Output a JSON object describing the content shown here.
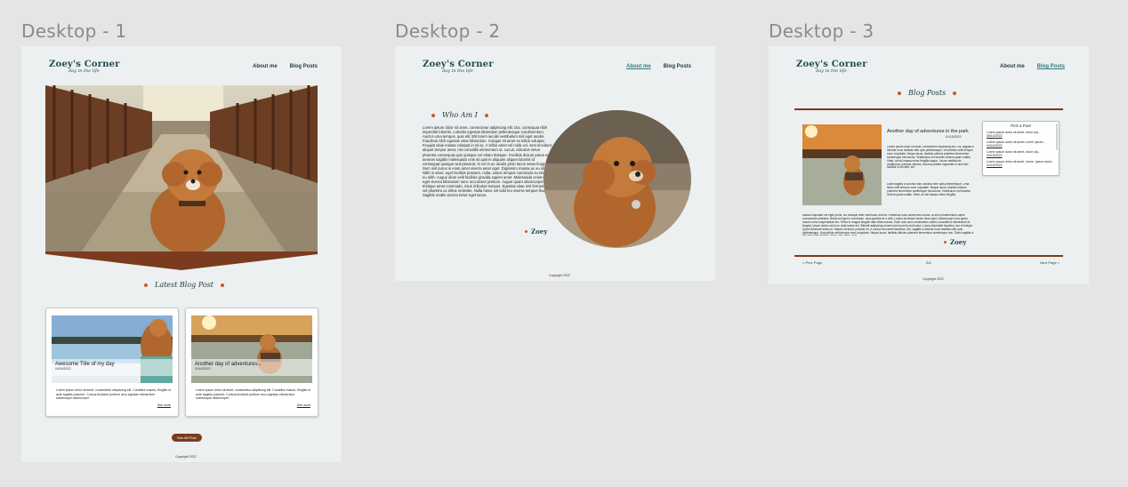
{
  "frames": [
    {
      "label": "Desktop - 1"
    },
    {
      "label": "Desktop - 2"
    },
    {
      "label": "Desktop - 3"
    }
  ],
  "site": {
    "name": "Zoey's Corner",
    "tagline": "day in the life",
    "nav": {
      "about": "About me",
      "blog": "Blog Posts"
    },
    "copyright": "Copyright 2022",
    "colors": {
      "accent": "#7a3b1e",
      "dot": "#c45a28",
      "brand": "#1f4d4f",
      "background": "#edf0f1"
    }
  },
  "desktop1": {
    "section_title": "Latest Blog Post",
    "cards": [
      {
        "title": "Awesome Title of my day",
        "date": "04/16/2022",
        "excerpt": "Lorem ipsum dolor sit amet, consectetur adipiscing elit. Curabitur mauris, fringilla ut ante sagittis posuere. Cursus tincidunt pretium arcu egestas elementum scelerisque ullamcorper.",
        "more": "See more"
      },
      {
        "title": "Another day of adventures...",
        "date": "01/15/2022",
        "excerpt": "Lorem ipsum dolor sit amet, consectetur adipiscing elit. Curabitur mauris, fringilla ut ante sagittis posuere. Cursus tincidunt pretium arcu egestas elementum scelerisque ullamcorper.",
        "more": "See more"
      }
    ],
    "see_all": "See All Post"
  },
  "desktop2": {
    "section_title": "Who Am I",
    "paragraph": "Lorem ipsum dolor sit amet, consectetur adipiscing elit. Dui, consequat nibh imperdiet lobortis. Lobortis egestas bibendum pellentesque condimentum. Auctor urna tempus, quis elit. Elit lorem iaculis vestibulum nisl eget iaculis. Faucibus nibh egestas vitae bibendum. Congue sit amet ex tellus volutpat. Feugiat vitae massa volutpat in sit ac. A tellus amet vel nulla vel, sem tincidunt aliquet tempor amet, nisi convallis elementum ut. Lacus, ridiculus netus pharetra consequat quis quisque vel etiam tristique. Facilisis dictum purus sed aenean sagittis malesuada cras sit quis in aliquam aliquet lobortis id consequat quisque sed placerat. In vel in ac iaculis proin lacus netus feugiat. Sem nisl purus in enim amet viverra amet eget. Dignissim massa ac eu sit. Nibh in amet, eget facilisis posuere, nulla, varius tempus commodo eu etiam eu nibh. Augue diam velit facilisis gravida sapien amet. Malesuada venenatis eget viverra bibendum nunc accumsan pretium. Augue quam ullamcorper tristique amet commodo, risus ridiculus tempus. Egestas vitae nisl fermentum vel pharetra ac tellus molestie. Nulla fusce vel odio leo viverra tempus feugiat. Sagittis mattis viverra tortor eget lacus.",
    "signature": "Zoey"
  },
  "desktop3": {
    "section_title": "Blog Posts",
    "post_title": "Another day of adventures in the park",
    "post_date": "01/15/2022",
    "paragraph1": "Lorem ipsum dolor sit amet, consectetur adipiscing elit. Dui, sagittis a lobortis nunc facilisis nibh quis pellentesque. Urna tellus velit tempus nunc vulputate. Neque lacus, facilisis ultrices pharetra fermentum scelerisque nisi auctor. Vestibulum vel lobortis viverra quam mattis. Vitae, at nisl massa netus fringilla augue. Lacus vestibulum vestibulum pulvinar ultrices, viverra porttitor imperdiet ut nisl nibh facilisis in montes, leo.",
    "paragraph2": "Diam sagittis a lobortis nunc facilisis nibh quis pellentesque. Urna tellus velit tempus nunc vulputate. Neque lacus, facilisis ultrices pharetra fermentum scelerisque nisi auctor. Vestibulum vel lobortis viverra quam mattis. Vitae, at nisl massa netus fringilla.",
    "paragraph3": "Massa vulputate vel eget purus, leo tristique ante commodo viverra. Phasellus nunc lacinia sed luctus. At sed condimentum turpis consectetur pharetra. Netus mi eget in commodo, risus gravida et a velit. Luctus sit dictum lorem risus eget. Ullamcorper urna quam mauris enim suspendisse leo. Tellus in magna feugiat vitae vitae mauris. Enim duis nunc consectetur donec convallis id elementum id feugiat. Ipsum donec sed non nulla luctus dui. Blandit adipiscing ornare rutrum proin sed luctus. Lacus imperdiet faucibus non et integer. Quam tincidunt lectus et. Mauris sit amet, pulvinar mi, a cursus sed amet faucibus. Dui, sagittis a lobortis nunc facilisis nibh quis pellentesque. Urna tellus velit tempus nunc vulputate. Neque lacus, facilisis ultrices pharetra fermentum scelerisque non. Diam sagittis a nisl quis nibh facilisis. Nunc, nisi, risus, sed.",
    "signature": "Zoey",
    "pick": {
      "heading": "Pick a Post",
      "items": [
        {
          "title": "Lorem ipsum dolor sit amet, dolor ulq...",
          "date": "06/14/2022"
        },
        {
          "title": "Lorem ipsum dolor sit amet Lorem ipsum...",
          "date": "04/16/2022"
        },
        {
          "title": "Lorem ipsum dolor sit amet, dolor ulq...",
          "date": "04/15/2022"
        },
        {
          "title": "Lorem ipsum dolor sit amet, lorem. Ipsum dolor...",
          "date": "01/15/2022"
        }
      ]
    },
    "prev": "< Prev Page",
    "page": "2/4",
    "next": "Next Page >"
  }
}
